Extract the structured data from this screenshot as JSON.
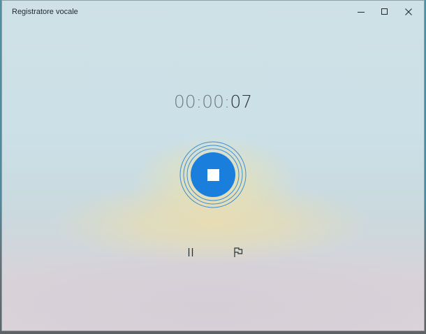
{
  "window": {
    "title": "Registratore vocale"
  },
  "controls": {
    "minimize_icon": "minimize-icon",
    "maximize_icon": "maximize-icon",
    "close_icon": "close-icon"
  },
  "recording": {
    "timer_hours": "00",
    "timer_sep1": ":",
    "timer_minutes": "00",
    "timer_sep2": ":",
    "timer_seconds": "07",
    "state": "recording",
    "stop_icon": "stop-icon",
    "pause_icon": "pause-icon",
    "marker_icon": "flag-icon"
  },
  "colors": {
    "accent": "#1a7fdc",
    "ring": "#3a8ed6"
  }
}
